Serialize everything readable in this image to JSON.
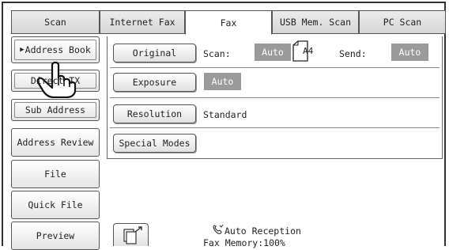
{
  "tabs": [
    {
      "label": "Scan"
    },
    {
      "label": "Internet Fax"
    },
    {
      "label": "Fax"
    },
    {
      "label": "USB Mem. Scan"
    },
    {
      "label": "PC Scan"
    }
  ],
  "left_menu": [
    {
      "label": "Address Book"
    },
    {
      "label": "Direct TX"
    },
    {
      "label": "Sub Address"
    },
    {
      "label": "Address Review"
    },
    {
      "label": "File"
    },
    {
      "label": "Quick File"
    },
    {
      "label": "Preview"
    }
  ],
  "settings": {
    "original_label": "Original",
    "scan_label": "Scan:",
    "scan_value": "Auto",
    "paper_size": "A4",
    "send_label": "Send:",
    "send_value": "Auto",
    "exposure_label": "Exposure",
    "exposure_value": "Auto",
    "resolution_label": "Resolution",
    "resolution_value": "Standard",
    "special_modes_label": "Special Modes"
  },
  "status": {
    "reception": "Auto Reception",
    "memory": "Fax Memory:100%"
  },
  "colors": {
    "chip": "#9a9a9a",
    "border": "#555555"
  }
}
